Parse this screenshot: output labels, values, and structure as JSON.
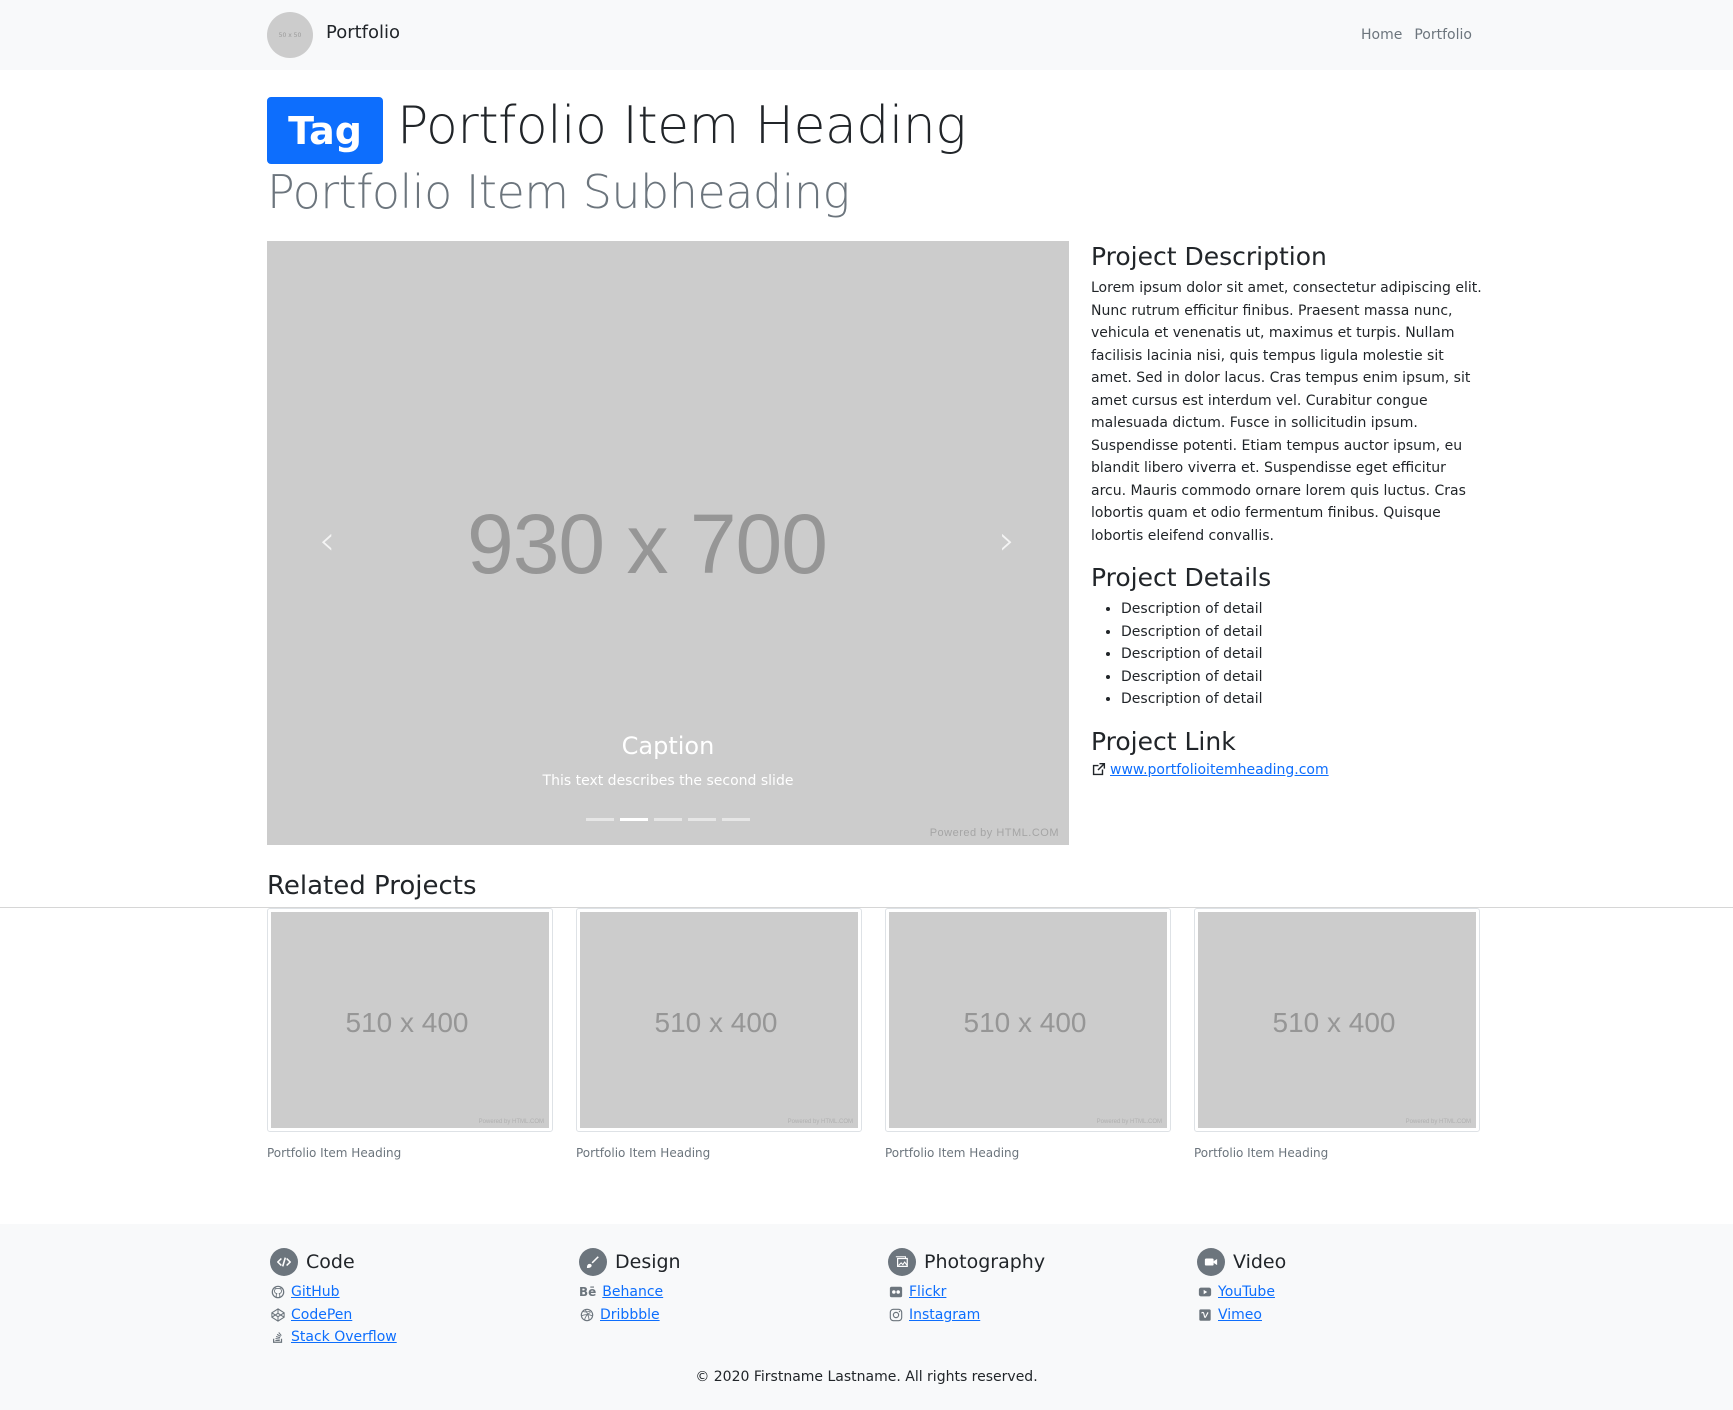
{
  "navbar": {
    "brand_logo_text": "50 x 50",
    "brand": "Portfolio",
    "links": [
      "Home",
      "Portfolio"
    ]
  },
  "header": {
    "tag": "Tag",
    "title": "Portfolio Item Heading",
    "subtitle": "Portfolio Item Subheading"
  },
  "carousel": {
    "placeholder": "930 x 700",
    "caption_title": "Caption",
    "caption_text": "This text describes the second slide",
    "indicator_count": 5,
    "active_indicator": 2,
    "powered": "Powered by HTML.COM"
  },
  "project": {
    "description_title": "Project Description",
    "description": "Lorem ipsum dolor sit amet, consectetur adipiscing elit. Nunc rutrum efficitur finibus. Praesent massa nunc, vehicula et venenatis ut, maximus et turpis. Nullam facilisis lacinia nisi, quis tempus ligula molestie sit amet. Sed in dolor lacus. Cras tempus enim ipsum, sit amet cursus est interdum vel. Curabitur congue malesuada dictum. Fusce in sollicitudin ipsum. Suspendisse potenti. Etiam tempus auctor ipsum, eu blandit libero viverra et. Suspendisse eget efficitur arcu. Mauris commodo ornare lorem quis luctus. Cras lobortis quam et odio fermentum finibus. Quisque lobortis eleifend convallis.",
    "details_title": "Project Details",
    "details": [
      "Description of detail",
      "Description of detail",
      "Description of detail",
      "Description of detail",
      "Description of detail"
    ],
    "link_title": "Project Link",
    "link": "www.portfolioitemheading.com"
  },
  "related": {
    "title": "Related Projects",
    "items": [
      {
        "placeholder": "510 x 400",
        "powered": "Powered by HTML.COM",
        "caption": "Portfolio Item Heading"
      },
      {
        "placeholder": "510 x 400",
        "powered": "Powered by HTML.COM",
        "caption": "Portfolio Item Heading"
      },
      {
        "placeholder": "510 x 400",
        "powered": "Powered by HTML.COM",
        "caption": "Portfolio Item Heading"
      },
      {
        "placeholder": "510 x 400",
        "powered": "Powered by HTML.COM",
        "caption": "Portfolio Item Heading"
      }
    ]
  },
  "footer": {
    "columns": [
      {
        "title": "Code",
        "icon": "code-icon",
        "links": [
          {
            "label": "GitHub",
            "icon": "github-icon"
          },
          {
            "label": "CodePen",
            "icon": "codepen-icon"
          },
          {
            "label": "Stack Overflow",
            "icon": "stackoverflow-icon"
          }
        ]
      },
      {
        "title": "Design",
        "icon": "brush-icon",
        "links": [
          {
            "label": "Behance",
            "icon": "behance-icon"
          },
          {
            "label": "Dribbble",
            "icon": "dribbble-icon"
          }
        ]
      },
      {
        "title": "Photography",
        "icon": "images-icon",
        "links": [
          {
            "label": "Flickr",
            "icon": "flickr-icon"
          },
          {
            "label": "Instagram",
            "icon": "instagram-icon"
          }
        ]
      },
      {
        "title": "Video",
        "icon": "video-icon",
        "links": [
          {
            "label": "YouTube",
            "icon": "youtube-icon"
          },
          {
            "label": "Vimeo",
            "icon": "vimeo-icon"
          }
        ]
      }
    ],
    "copyright": "© 2020 Firstname Lastname. All rights reserved."
  },
  "colors": {
    "primary": "#0d6efd",
    "placeholder_bg": "#cccccc",
    "muted": "#6c757d",
    "light_bg": "#f8f9fa"
  }
}
